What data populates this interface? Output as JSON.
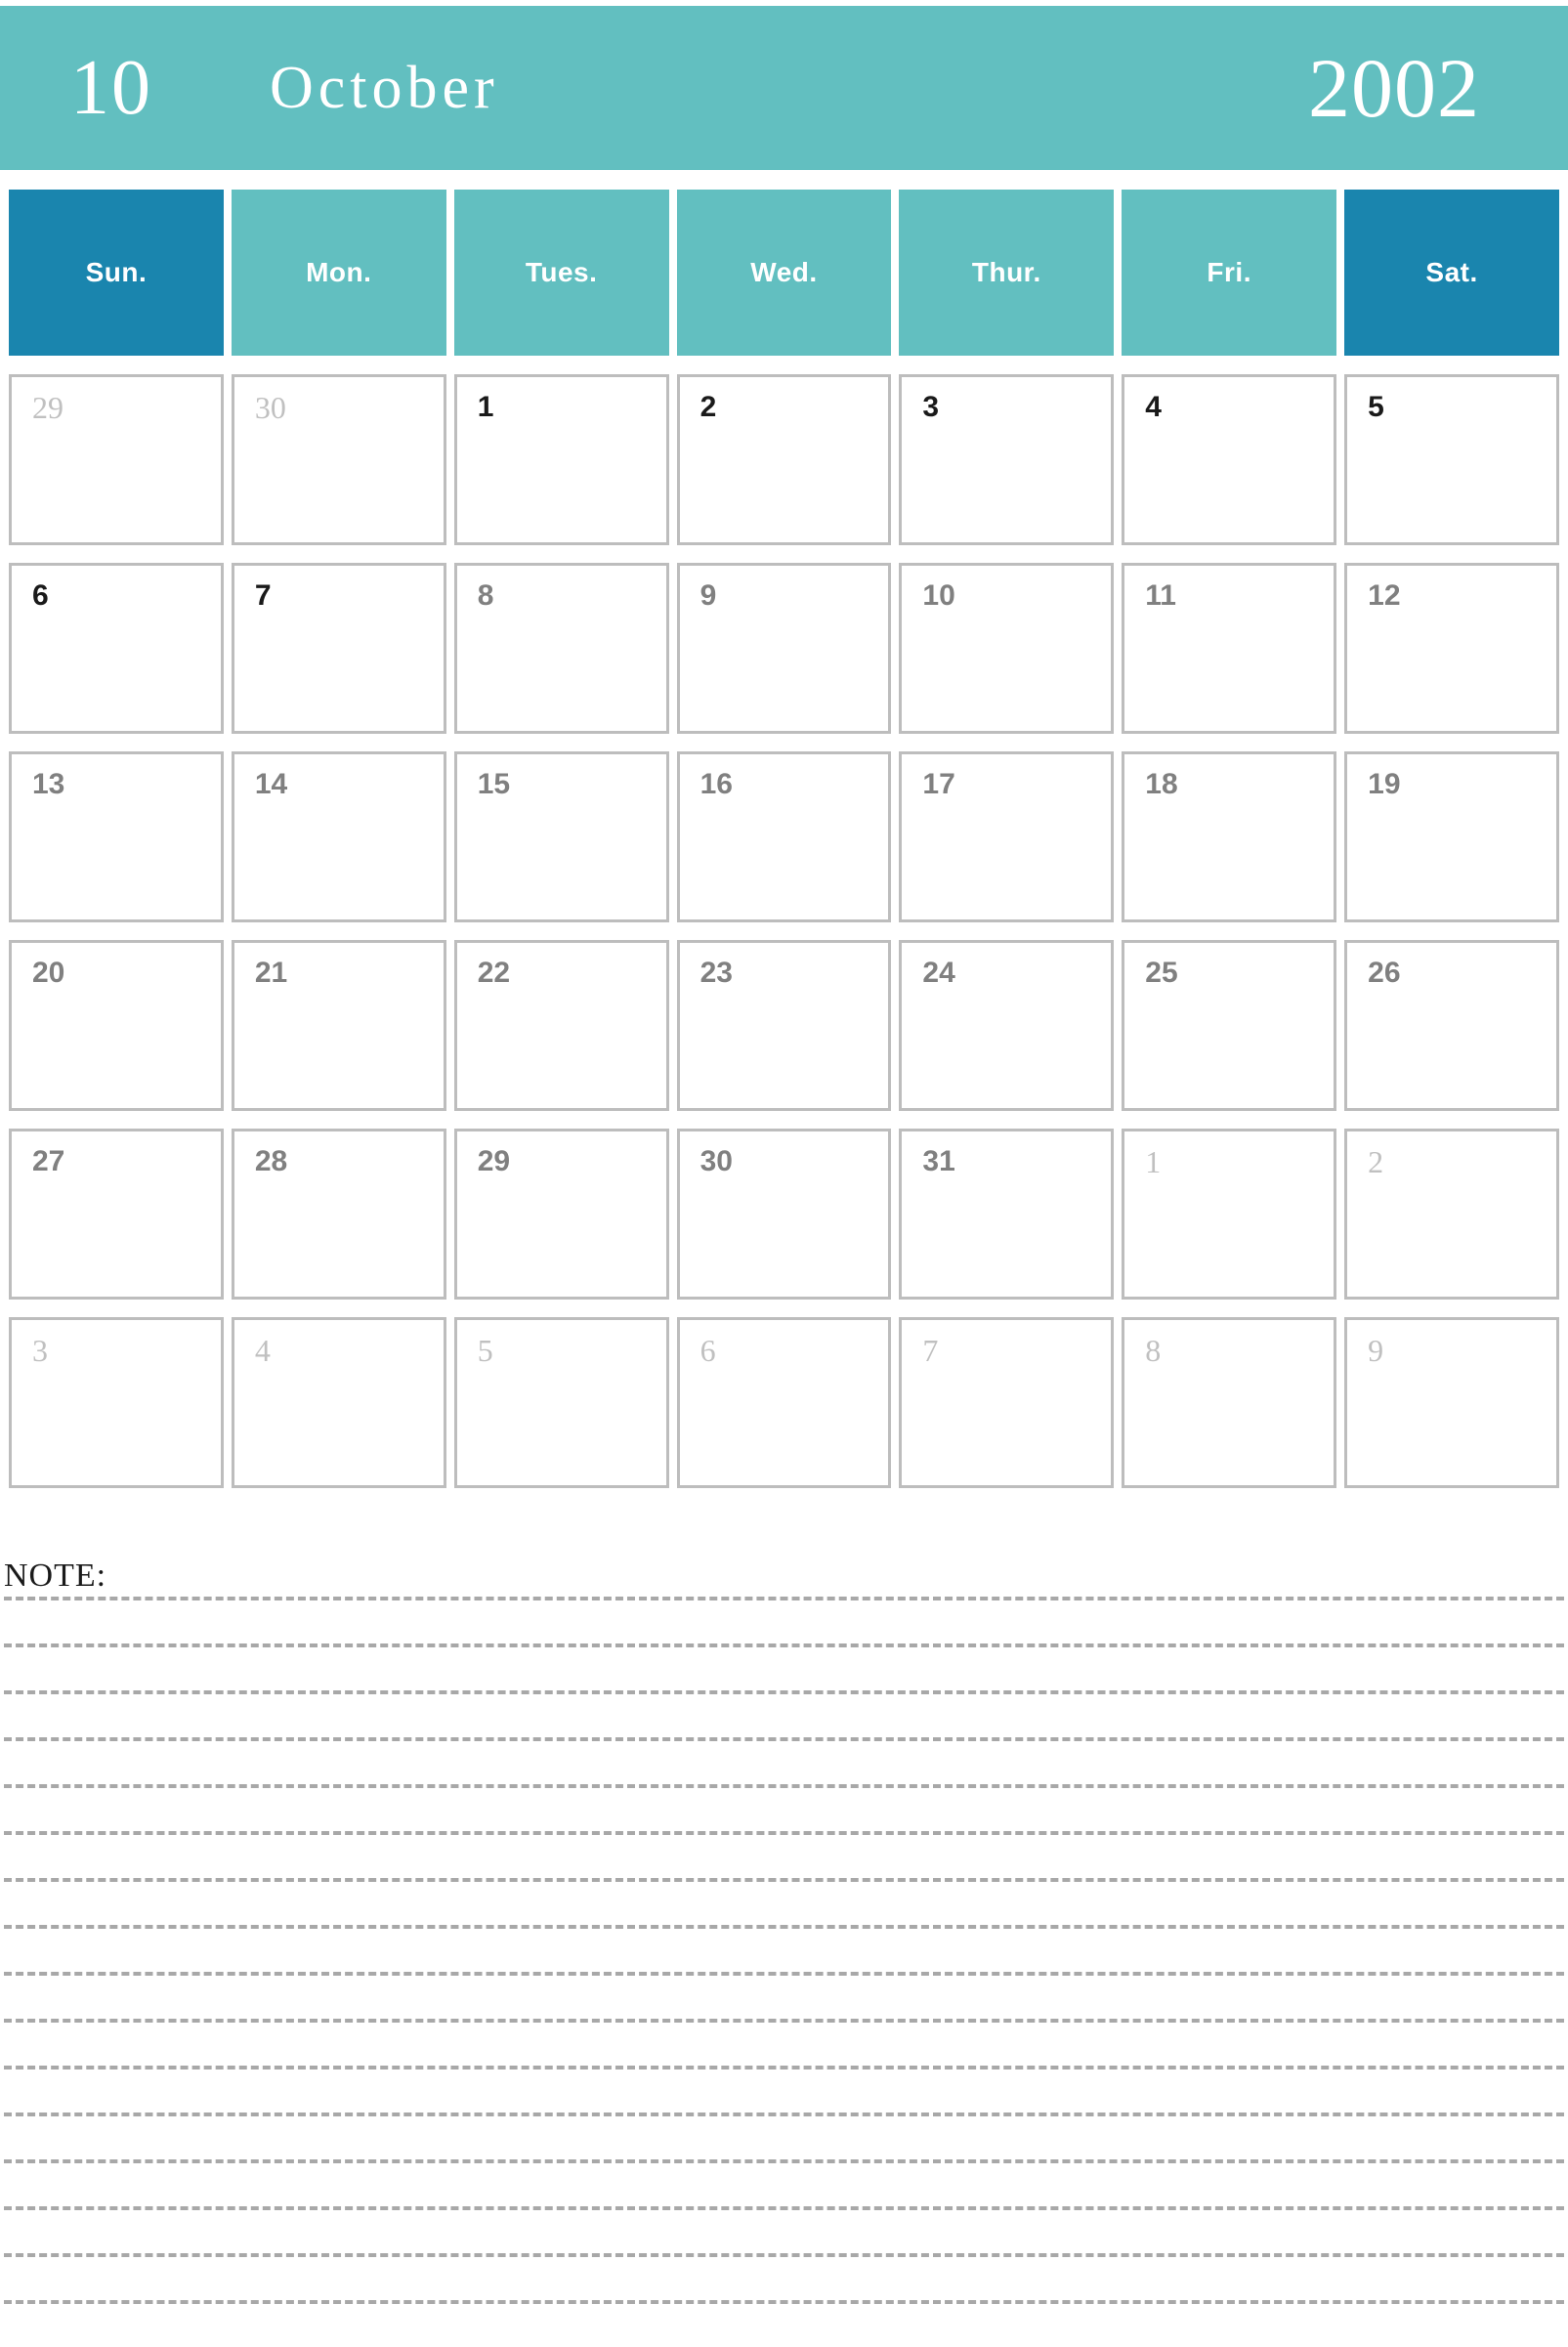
{
  "header": {
    "month_number": "10",
    "month_name": "October",
    "year": "2002",
    "banner_color": "#62bfc0"
  },
  "weekdays": [
    {
      "label": "Sun.",
      "weekend": true,
      "color": "#1a85ae"
    },
    {
      "label": "Mon.",
      "weekend": false,
      "color": "#62bfc0"
    },
    {
      "label": "Tues.",
      "weekend": false,
      "color": "#62bfc0"
    },
    {
      "label": "Wed.",
      "weekend": false,
      "color": "#62bfc0"
    },
    {
      "label": "Thur.",
      "weekend": false,
      "color": "#62bfc0"
    },
    {
      "label": "Fri.",
      "weekend": false,
      "color": "#62bfc0"
    },
    {
      "label": "Sat.",
      "weekend": true,
      "color": "#1a85ae"
    }
  ],
  "calendar": {
    "cell_border_color": "#bdbdbd",
    "weeks": [
      [
        {
          "day": "29",
          "style": "outside"
        },
        {
          "day": "30",
          "style": "outside"
        },
        {
          "day": "1",
          "style": "strong"
        },
        {
          "day": "2",
          "style": "strong"
        },
        {
          "day": "3",
          "style": "strong"
        },
        {
          "day": "4",
          "style": "strong"
        },
        {
          "day": "5",
          "style": "strong"
        }
      ],
      [
        {
          "day": "6",
          "style": "strong"
        },
        {
          "day": "7",
          "style": "strong"
        },
        {
          "day": "8",
          "style": "muted"
        },
        {
          "day": "9",
          "style": "muted"
        },
        {
          "day": "10",
          "style": "muted"
        },
        {
          "day": "11",
          "style": "muted"
        },
        {
          "day": "12",
          "style": "muted"
        }
      ],
      [
        {
          "day": "13",
          "style": "muted"
        },
        {
          "day": "14",
          "style": "muted"
        },
        {
          "day": "15",
          "style": "muted"
        },
        {
          "day": "16",
          "style": "muted"
        },
        {
          "day": "17",
          "style": "muted"
        },
        {
          "day": "18",
          "style": "muted"
        },
        {
          "day": "19",
          "style": "muted"
        }
      ],
      [
        {
          "day": "20",
          "style": "muted"
        },
        {
          "day": "21",
          "style": "muted"
        },
        {
          "day": "22",
          "style": "muted"
        },
        {
          "day": "23",
          "style": "muted"
        },
        {
          "day": "24",
          "style": "muted"
        },
        {
          "day": "25",
          "style": "muted"
        },
        {
          "day": "26",
          "style": "muted"
        }
      ],
      [
        {
          "day": "27",
          "style": "muted"
        },
        {
          "day": "28",
          "style": "muted"
        },
        {
          "day": "29",
          "style": "muted"
        },
        {
          "day": "30",
          "style": "muted"
        },
        {
          "day": "31",
          "style": "muted"
        },
        {
          "day": "1",
          "style": "outside"
        },
        {
          "day": "2",
          "style": "outside"
        }
      ],
      [
        {
          "day": "3",
          "style": "outside"
        },
        {
          "day": "4",
          "style": "outside"
        },
        {
          "day": "5",
          "style": "outside"
        },
        {
          "day": "6",
          "style": "outside"
        },
        {
          "day": "7",
          "style": "outside"
        },
        {
          "day": "8",
          "style": "outside"
        },
        {
          "day": "9",
          "style": "outside"
        }
      ]
    ]
  },
  "note": {
    "label": "NOTE:",
    "line_count": 16,
    "line_color": "#a8a8a8"
  }
}
